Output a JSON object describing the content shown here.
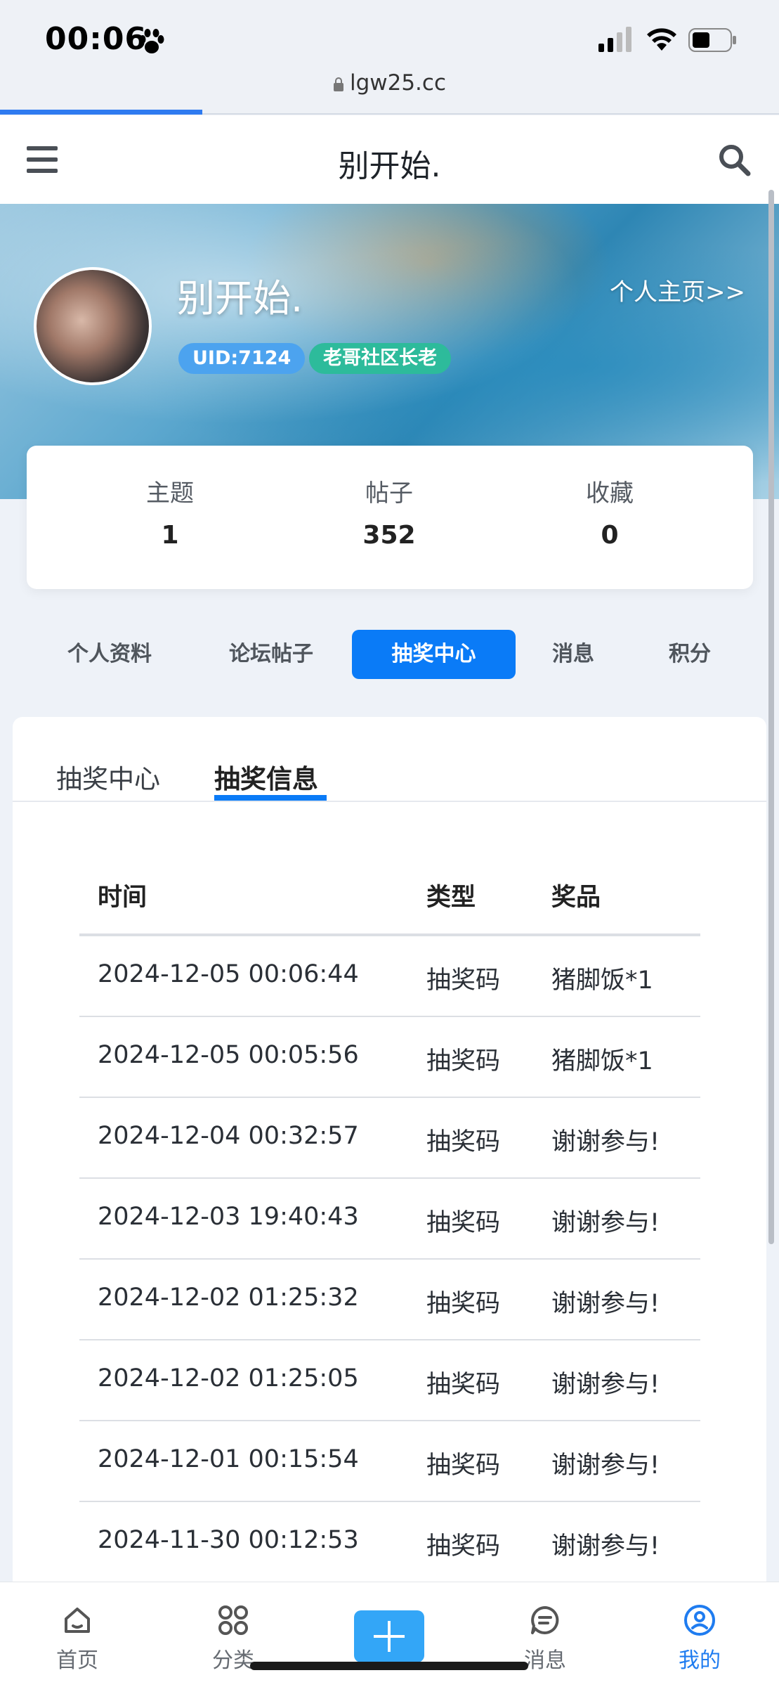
{
  "status_bar": {
    "time": "00:06",
    "url": "lgw25.cc"
  },
  "app_bar": {
    "title": "别开始."
  },
  "profile": {
    "username": "别开始.",
    "home_link": "个人主页>>",
    "uid": "UID:7124",
    "rank": "老哥社区长老"
  },
  "stats": [
    {
      "label": "主题",
      "value": "1"
    },
    {
      "label": "帖子",
      "value": "352"
    },
    {
      "label": "收藏",
      "value": "0"
    }
  ],
  "nav_tabs": [
    "个人资料",
    "论坛帖子",
    "抽奖中心",
    "消息",
    "积分"
  ],
  "nav_active": "抽奖中心",
  "sub_tabs": [
    "抽奖中心",
    "抽奖信息"
  ],
  "sub_active": "抽奖信息",
  "table": {
    "headers": [
      "时间",
      "类型",
      "奖品"
    ],
    "rows": [
      [
        "2024-12-05 00:06:44",
        "抽奖码",
        "猪脚饭*1"
      ],
      [
        "2024-12-05 00:05:56",
        "抽奖码",
        "猪脚饭*1"
      ],
      [
        "2024-12-04 00:32:57",
        "抽奖码",
        "谢谢参与!"
      ],
      [
        "2024-12-03 19:40:43",
        "抽奖码",
        "谢谢参与!"
      ],
      [
        "2024-12-02 01:25:32",
        "抽奖码",
        "谢谢参与!"
      ],
      [
        "2024-12-02 01:25:05",
        "抽奖码",
        "谢谢参与!"
      ],
      [
        "2024-12-01 00:15:54",
        "抽奖码",
        "谢谢参与!"
      ],
      [
        "2024-11-30 00:12:53",
        "抽奖码",
        "谢谢参与!"
      ]
    ]
  },
  "tab_bar": [
    {
      "label": "首页",
      "icon": "home-icon"
    },
    {
      "label": "分类",
      "icon": "grid-icon"
    },
    {
      "label": "",
      "icon": "plus-icon"
    },
    {
      "label": "消息",
      "icon": "chat-icon"
    },
    {
      "label": "我的",
      "icon": "user-icon"
    }
  ],
  "colors": {
    "accent": "#0a7bf7",
    "uid_badge": "#4ca3ef",
    "rank_badge": "#2dbb9b"
  }
}
